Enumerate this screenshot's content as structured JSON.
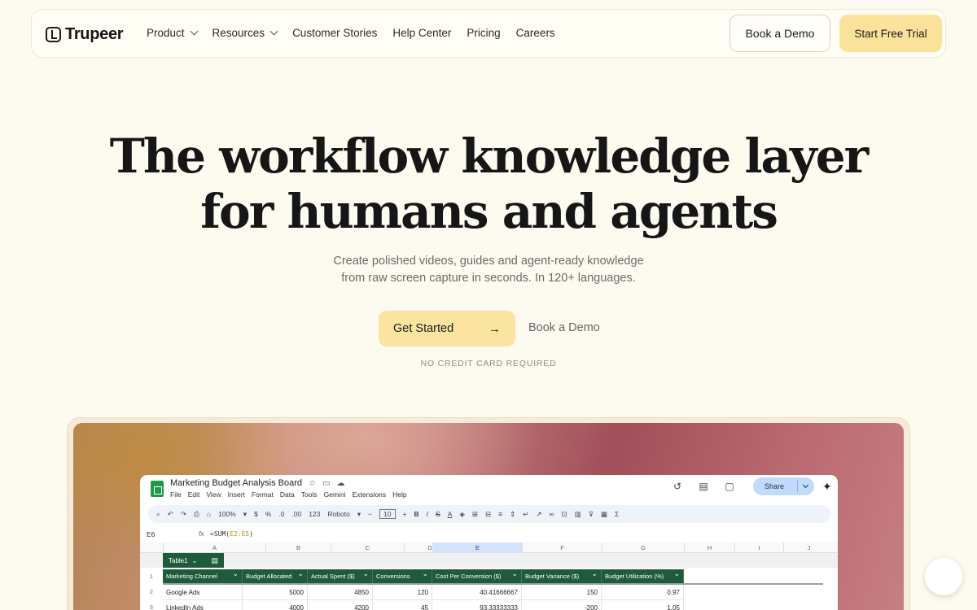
{
  "nav": {
    "logo": "Trupeer",
    "links": [
      {
        "label": "Product",
        "dropdown": true
      },
      {
        "label": "Resources",
        "dropdown": true
      },
      {
        "label": "Customer Stories",
        "dropdown": false
      },
      {
        "label": "Help Center",
        "dropdown": false
      },
      {
        "label": "Pricing",
        "dropdown": false
      },
      {
        "label": "Careers",
        "dropdown": false
      }
    ],
    "book_demo": "Book a Demo",
    "start_trial": "Start Free Trial"
  },
  "hero": {
    "headline_line1": "The workflow knowledge layer",
    "headline_line2": "for humans and agents",
    "sub_line1": "Create polished videos, guides and agent-ready knowledge",
    "sub_line2": "from raw screen capture in seconds. In 120+ languages.",
    "get_started": "Get Started",
    "get_started_arrow": "→",
    "book_demo": "Book a Demo",
    "no_credit": "NO CREDIT CARD REQUIRED"
  },
  "sheet": {
    "title": "Marketing Budget Analysis Board",
    "menu": [
      "File",
      "Edit",
      "View",
      "Insert",
      "Format",
      "Data",
      "Tools",
      "Gemini",
      "Extensions",
      "Help"
    ],
    "share": "Share",
    "toolbar": {
      "zoom": "100%",
      "currency": "$",
      "percent": "%",
      "dec_less": ".0",
      "dec_more": ".00",
      "num_format": "123",
      "font": "Roboto",
      "font_size": "10"
    },
    "cell_ref": "E6",
    "fx": "fx",
    "formula_prefix": "=SUM(",
    "formula_range": "E2:E5",
    "formula_suffix": ")",
    "columns": [
      "A",
      "B",
      "C",
      "D",
      "E",
      "F",
      "G",
      "H",
      "I",
      "J"
    ],
    "table_name": "Table1",
    "headers": [
      "Marketing Channel",
      "Budget Allocated",
      "Actual Spent ($)",
      "Conversions",
      "Cost Per Conversion ($)",
      "Budget Variance ($)",
      "Budget Utilization (%)"
    ],
    "row_numbers": [
      "1",
      "2",
      "3"
    ],
    "rows": [
      [
        "Google Ads",
        "5000",
        "4850",
        "120",
        "40.41666667",
        "150",
        "0.97"
      ],
      [
        "LinkedIn Ads",
        "4000",
        "4200",
        "45",
        "93.33333333",
        "-200",
        "1.05"
      ]
    ]
  }
}
